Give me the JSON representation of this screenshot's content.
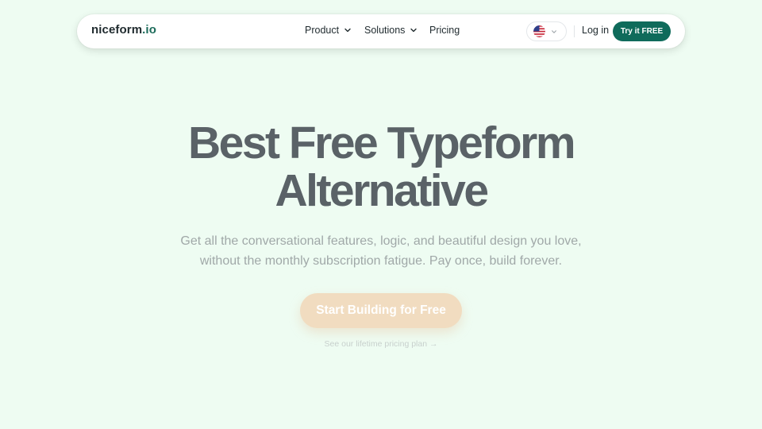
{
  "header": {
    "logo_main": "niceform",
    "logo_suffix": ".io",
    "nav": {
      "product": "Product",
      "solutions": "Solutions",
      "pricing": "Pricing"
    },
    "language_icon": "us-flag-icon",
    "login": "Log in",
    "try_button": "Try it FREE"
  },
  "hero": {
    "title_line1": "Best Free Typeform",
    "title_line2": "Alternative",
    "subtitle_line1": "Get all the conversational features, logic, and beautiful design you love,",
    "subtitle_line2": "without the monthly subscription fatigue. Pay once, build forever.",
    "cta_label": "Start Building for Free",
    "pricing_link": "See our lifetime pricing plan →"
  },
  "colors": {
    "background": "#eefcf2",
    "brand_green": "#0f6b5b",
    "cta_peach": "#f1dcc0",
    "title_gray": "#5a6267"
  }
}
